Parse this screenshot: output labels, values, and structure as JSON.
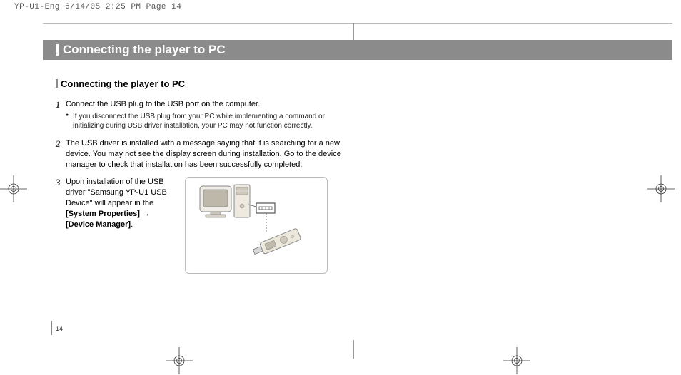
{
  "header": {
    "slug": "YP-U1-Eng  6/14/05 2:25 PM  Page 14"
  },
  "title": "Connecting the player to PC",
  "section": {
    "heading": "Connecting the player to PC"
  },
  "steps": {
    "s1_num": "1",
    "s1_text": "Connect the USB plug to the USB port on the computer.",
    "s1_bullet": "If you disconnect the USB plug from your PC while implementing a command or initializing during USB driver installation, your PC may not function correctly.",
    "s2_num": "2",
    "s2_text": "The USB driver is installed with a message saying that it is searching for a new device. You may not see the display screen during installation. Go to the device manager to check that installation has been successfully completed.",
    "s3_num": "3",
    "s3_pre": "Upon installation of the USB driver \"Samsung YP-U1 USB Device\" will appear in the ",
    "s3_b1": "[System Properties]",
    "s3_arrow": " → ",
    "s3_b2": "[Device Manager]",
    "s3_end": "."
  },
  "page_number": "14"
}
